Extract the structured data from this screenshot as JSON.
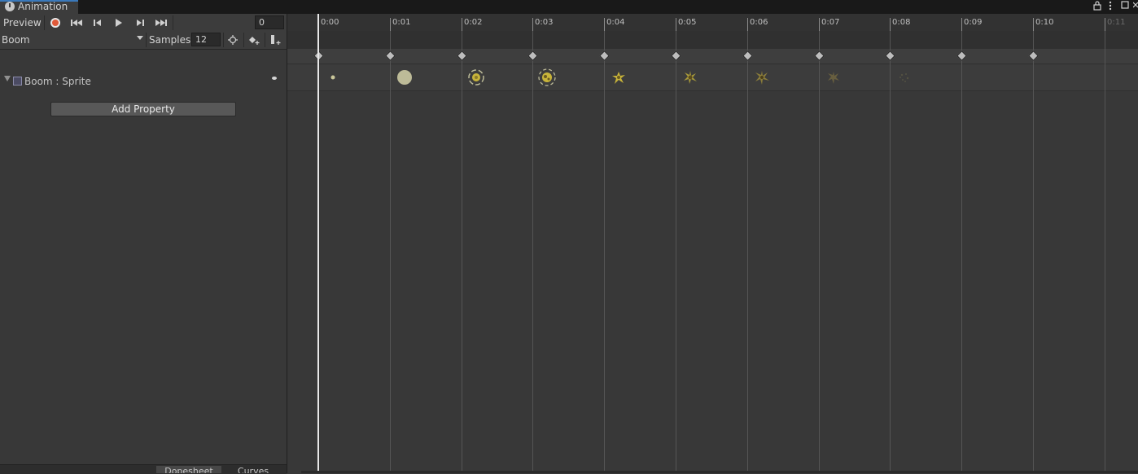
{
  "window": {
    "tab_title": "Animation",
    "lock_icon": "lock-icon",
    "menu_icon": "kebab-menu-icon"
  },
  "toolbar": {
    "preview_label": "Preview",
    "frame_value": "0"
  },
  "clip": {
    "name": "Boom",
    "samples_label": "Samples",
    "samples_value": "12"
  },
  "property": {
    "label": "Boom : Sprite",
    "add_button": "Add Property"
  },
  "timeline": {
    "ticks": [
      "0:00",
      "0:01",
      "0:02",
      "0:03",
      "0:04",
      "0:05",
      "0:06",
      "0:07",
      "0:08",
      "0:09",
      "0:10",
      "0:11"
    ],
    "keyframe_count": 11,
    "sprite_count": 9
  },
  "bottom_tabs": {
    "dopesheet": "Dopesheet",
    "curves": "Curves"
  },
  "colors": {
    "accent": "#3a79bb",
    "record": "#e05a3a",
    "sprite": "#c8b43a"
  }
}
